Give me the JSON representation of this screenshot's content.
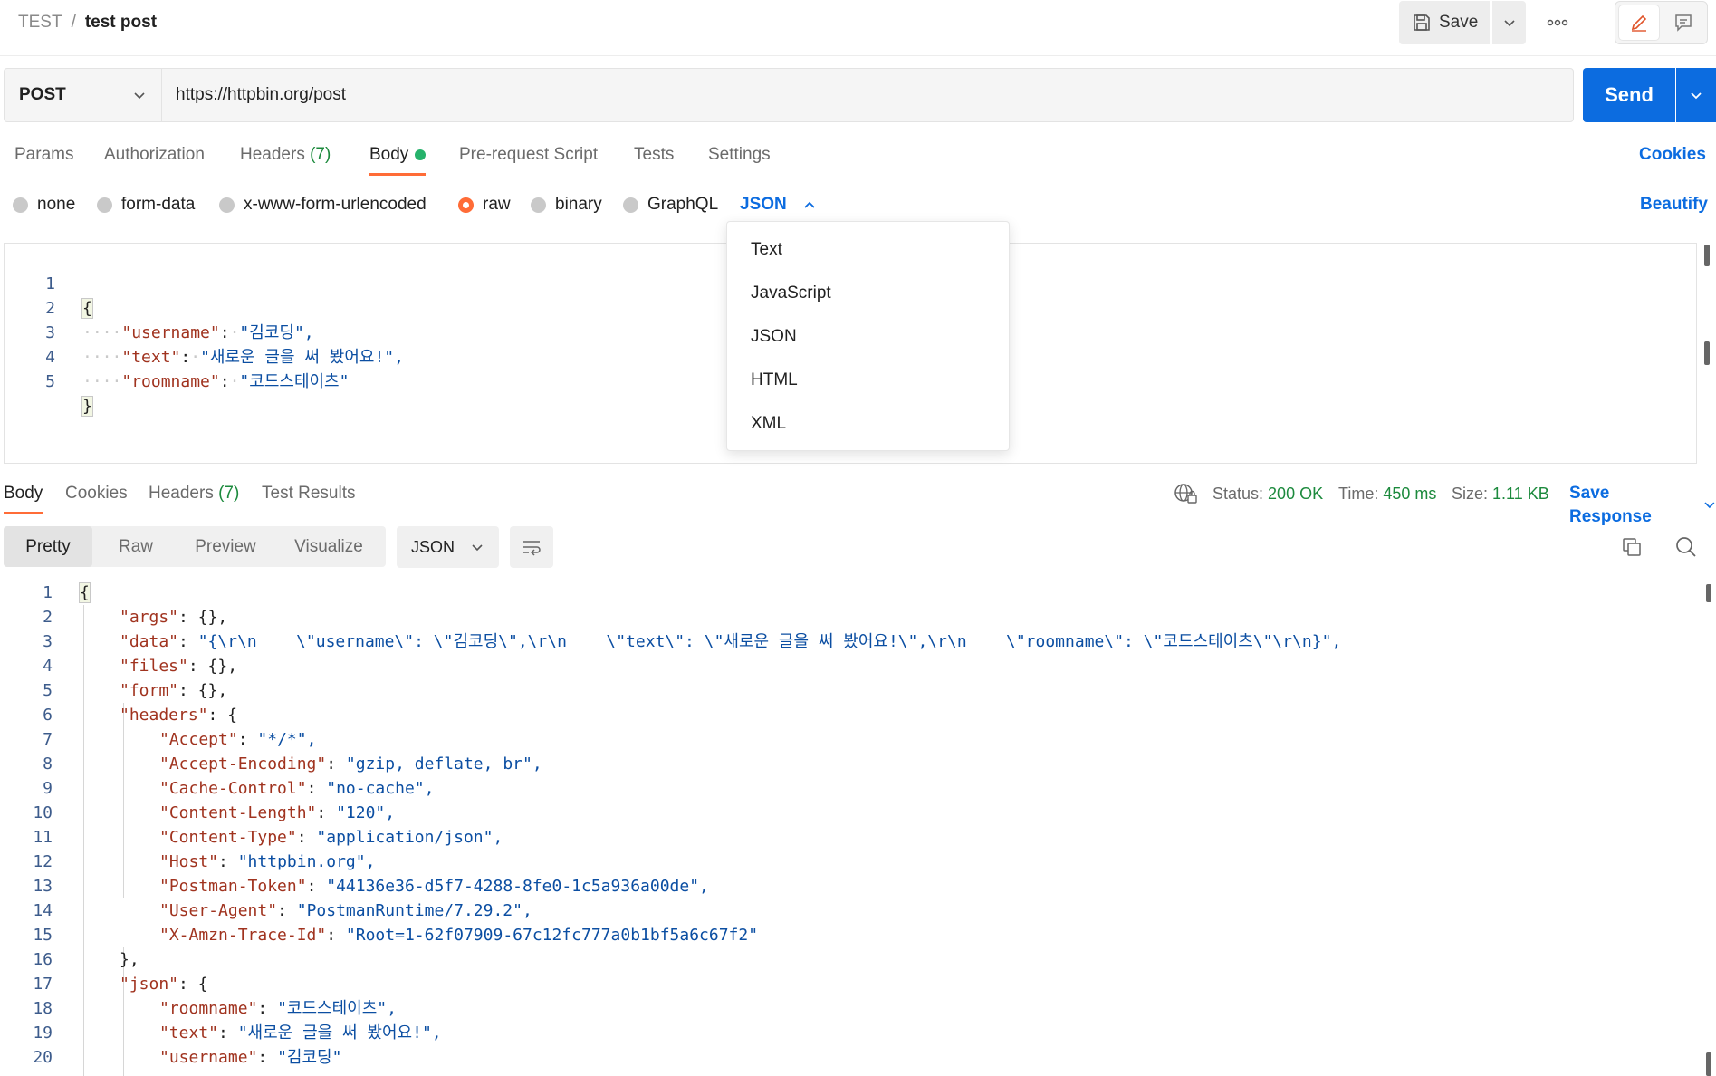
{
  "breadcrumb": {
    "collection": "TEST",
    "separator": "/",
    "request": "test post"
  },
  "toolbar": {
    "save_label": "Save"
  },
  "request": {
    "method": "POST",
    "url": "https://httpbin.org/post",
    "send_label": "Send",
    "tabs": [
      {
        "label": "Params"
      },
      {
        "label": "Authorization"
      },
      {
        "label": "Headers",
        "count": "(7)"
      },
      {
        "label": "Body"
      },
      {
        "label": "Pre-request Script"
      },
      {
        "label": "Tests"
      },
      {
        "label": "Settings"
      }
    ],
    "cookies_label": "Cookies",
    "body_types": [
      "none",
      "form-data",
      "x-www-form-urlencoded",
      "raw",
      "binary",
      "GraphQL"
    ],
    "selected_body_type": "raw",
    "format": "JSON",
    "beautify_label": "Beautify",
    "format_options": [
      "Text",
      "JavaScript",
      "JSON",
      "HTML",
      "XML"
    ],
    "editor_line_numbers": [
      "1",
      "2",
      "3",
      "4",
      "5"
    ],
    "editor_lines": [
      {
        "key": "",
        "value": "{"
      },
      {
        "key": "\"username\"",
        "value": "\"김코딩\","
      },
      {
        "key": "\"text\"",
        "value": "\"새로운 글을 써 봤어요!\","
      },
      {
        "key": "\"roomname\"",
        "value": "\"코드스테이츠\""
      },
      {
        "key": "",
        "value": "}"
      }
    ]
  },
  "response": {
    "tabs": [
      {
        "label": "Body"
      },
      {
        "label": "Cookies"
      },
      {
        "label": "Headers",
        "count": "(7)"
      },
      {
        "label": "Test Results"
      }
    ],
    "status_label": "Status:",
    "status_value": "200 OK",
    "time_label": "Time:",
    "time_value": "450 ms",
    "size_label": "Size:",
    "size_value": "1.11 KB",
    "save_response_label": "Save Response",
    "view_modes": [
      "Pretty",
      "Raw",
      "Preview",
      "Visualize"
    ],
    "format": "JSON",
    "line_numbers": [
      "1",
      "2",
      "3",
      "4",
      "5",
      "6",
      "7",
      "8",
      "9",
      "10",
      "11",
      "12",
      "13",
      "14",
      "15",
      "16",
      "17",
      "18",
      "19",
      "20"
    ],
    "lines": [
      {
        "key": "",
        "value": "{"
      },
      {
        "key": "\"args\"",
        "value": "{},"
      },
      {
        "key": "\"data\"",
        "value": "\"{\\r\\n    \\\"username\\\": \\\"김코딩\\\",\\r\\n    \\\"text\\\": \\\"새로운 글을 써 봤어요!\\\",\\r\\n    \\\"roomname\\\": \\\"코드스테이츠\\\"\\r\\n}\","
      },
      {
        "key": "\"files\"",
        "value": "{},"
      },
      {
        "key": "\"form\"",
        "value": "{},"
      },
      {
        "key": "\"headers\"",
        "value": "{"
      },
      {
        "key": "\"Accept\"",
        "value": "\"*/*\","
      },
      {
        "key": "\"Accept-Encoding\"",
        "value": "\"gzip, deflate, br\","
      },
      {
        "key": "\"Cache-Control\"",
        "value": "\"no-cache\","
      },
      {
        "key": "\"Content-Length\"",
        "value": "\"120\","
      },
      {
        "key": "\"Content-Type\"",
        "value": "\"application/json\","
      },
      {
        "key": "\"Host\"",
        "value": "\"httpbin.org\","
      },
      {
        "key": "\"Postman-Token\"",
        "value": "\"44136e36-d5f7-4288-8fe0-1c5a936a00de\","
      },
      {
        "key": "\"User-Agent\"",
        "value": "\"PostmanRuntime/7.29.2\","
      },
      {
        "key": "\"X-Amzn-Trace-Id\"",
        "value": "\"Root=1-62f07909-67c12fc777a0b1bf5a6c67f2\""
      },
      {
        "key": "",
        "value": "},"
      },
      {
        "key": "\"json\"",
        "value": "{"
      },
      {
        "key": "\"roomname\"",
        "value": "\"코드스테이츠\","
      },
      {
        "key": "\"text\"",
        "value": "\"새로운 글을 써 봤어요!\","
      },
      {
        "key": "\"username\"",
        "value": "\"김코딩\""
      }
    ]
  }
}
